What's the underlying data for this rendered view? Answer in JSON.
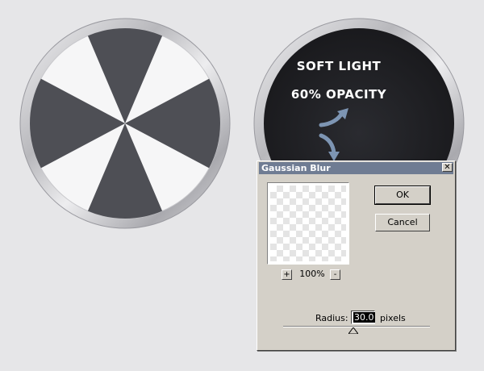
{
  "overlay": {
    "blend_mode_label": "SOFT LIGHT",
    "opacity_label": "60% OPACITY"
  },
  "dialog": {
    "title": "Gaussian Blur",
    "close_glyph": "✕",
    "preview": {
      "zoom_in_glyph": "+",
      "zoom_out_glyph": "-",
      "zoom_level": "100%"
    },
    "buttons": {
      "ok": "OK",
      "cancel": "Cancel"
    },
    "radius": {
      "label": "Radius:",
      "value": "30.0",
      "units": "pixels",
      "slider_fraction": 0.48
    }
  },
  "colors": {
    "page_background": "#e6e6e8",
    "dark_pie": "#4e4f55",
    "light_pie": "#f6f6f7",
    "dark_circle": "#1e1e22",
    "arrow": "#7d95b3",
    "dialog_title_bar": "#6f7c93",
    "dialog_face": "#d4d0c8"
  }
}
